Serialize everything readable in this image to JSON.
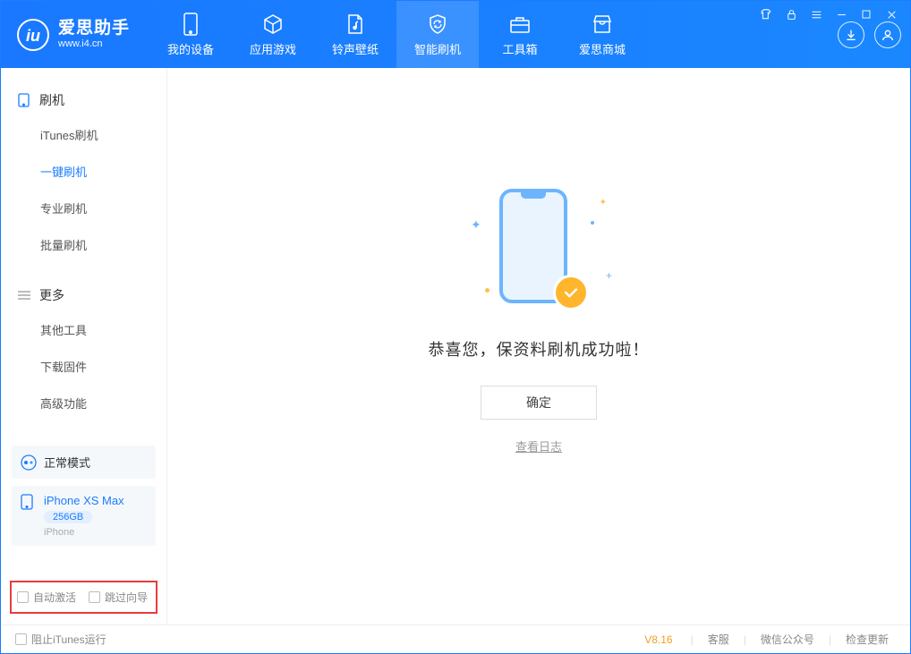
{
  "app": {
    "title": "爱思助手",
    "subtitle": "www.i4.cn"
  },
  "nav": {
    "items": [
      {
        "label": "我的设备"
      },
      {
        "label": "应用游戏"
      },
      {
        "label": "铃声壁纸"
      },
      {
        "label": "智能刷机"
      },
      {
        "label": "工具箱"
      },
      {
        "label": "爱思商城"
      }
    ]
  },
  "sidebar": {
    "group1": {
      "title": "刷机",
      "items": [
        {
          "label": "iTunes刷机"
        },
        {
          "label": "一键刷机"
        },
        {
          "label": "专业刷机"
        },
        {
          "label": "批量刷机"
        }
      ]
    },
    "group2": {
      "title": "更多",
      "items": [
        {
          "label": "其他工具"
        },
        {
          "label": "下载固件"
        },
        {
          "label": "高级功能"
        }
      ]
    }
  },
  "device": {
    "mode": "正常模式",
    "name": "iPhone XS Max",
    "capacity": "256GB",
    "type": "iPhone"
  },
  "checks": {
    "auto_activate": "自动激活",
    "skip_guide": "跳过向导"
  },
  "main": {
    "success_title": "恭喜您，保资料刷机成功啦！",
    "ok_button": "确定",
    "view_log": "查看日志"
  },
  "statusbar": {
    "block_itunes": "阻止iTunes运行",
    "version": "V8.16",
    "links": [
      {
        "label": "客服"
      },
      {
        "label": "微信公众号"
      },
      {
        "label": "检查更新"
      }
    ]
  }
}
